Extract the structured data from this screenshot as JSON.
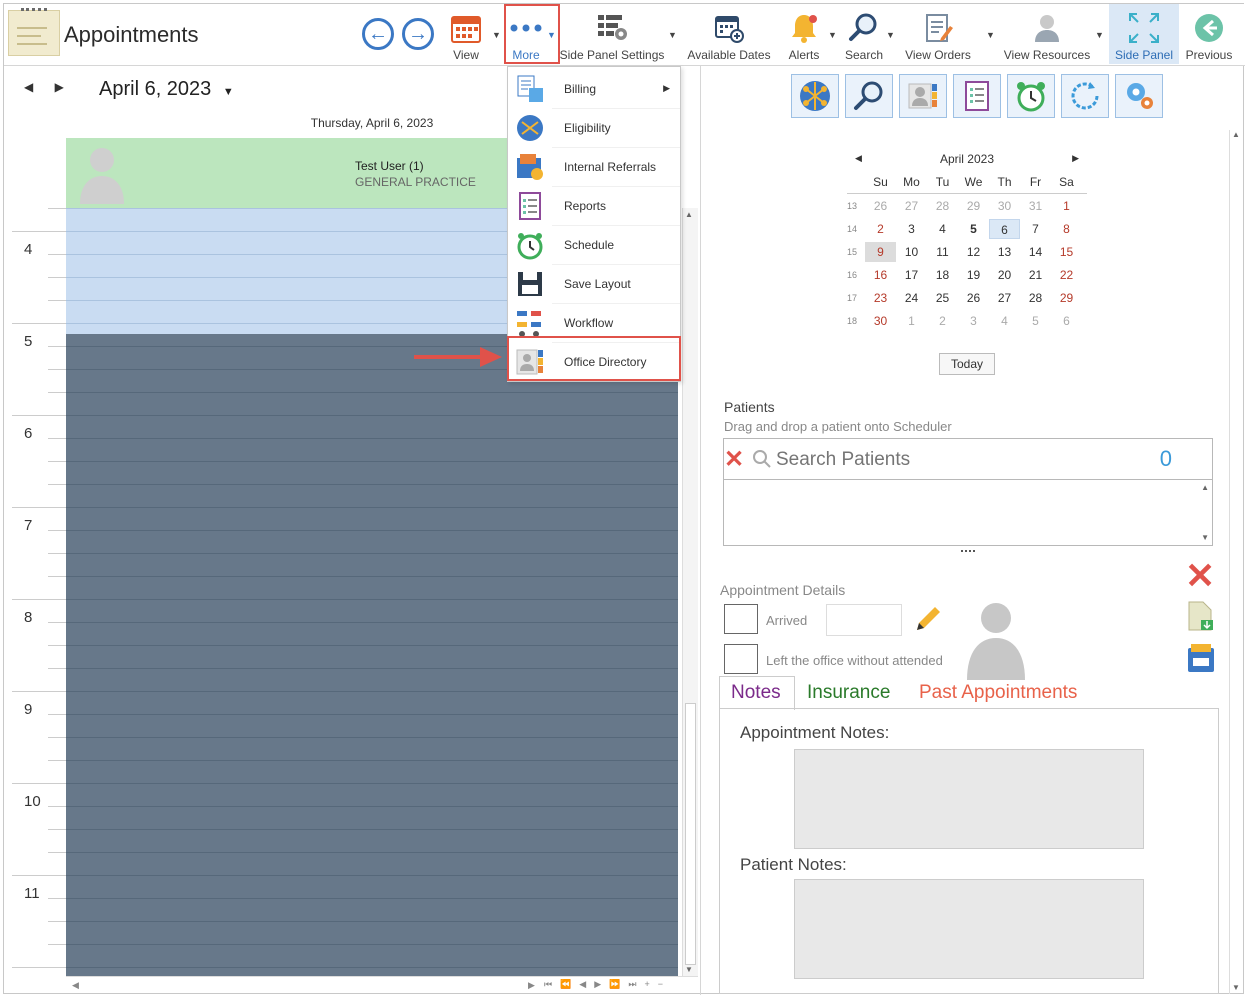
{
  "app": {
    "title": "Appointments"
  },
  "toolbar": {
    "view": "View",
    "more": "More",
    "side_panel_settings": "Side Panel Settings",
    "available_dates": "Available Dates",
    "alerts": "Alerts",
    "search": "Search",
    "view_orders": "View Orders",
    "view_resources": "View Resources",
    "side_panel": "Side Panel",
    "previous": "Previous"
  },
  "scheduler": {
    "date": "April 6, 2023",
    "day_header": "Thursday, April 6, 2023",
    "resource_name": "Test User (1)",
    "resource_practice": "GENERAL PRACTICE",
    "hours": [
      "4",
      "5",
      "6",
      "7",
      "8",
      "9",
      "10",
      "11"
    ]
  },
  "more_menu": {
    "items": [
      {
        "label": "Billing",
        "icon": "billing-icon"
      },
      {
        "label": "Eligibility",
        "icon": "eligibility-icon"
      },
      {
        "label": "Internal Referrals",
        "icon": "referrals-icon"
      },
      {
        "label": "Reports",
        "icon": "reports-icon"
      },
      {
        "label": "Schedule",
        "icon": "schedule-icon"
      },
      {
        "label": "Save Layout",
        "icon": "save-icon"
      },
      {
        "label": "Workflow",
        "icon": "workflow-icon"
      },
      {
        "label": "Office Directory",
        "icon": "office-directory-icon"
      }
    ]
  },
  "calendar": {
    "month": "April 2023",
    "weekdays": [
      "Su",
      "Mo",
      "Tu",
      "We",
      "Th",
      "Fr",
      "Sa"
    ],
    "weeks": [
      {
        "wk": "13",
        "days": [
          "26",
          "27",
          "28",
          "29",
          "30",
          "31",
          "1"
        ]
      },
      {
        "wk": "14",
        "days": [
          "2",
          "3",
          "4",
          "5",
          "6",
          "7",
          "8"
        ]
      },
      {
        "wk": "15",
        "days": [
          "9",
          "10",
          "11",
          "12",
          "13",
          "14",
          "15"
        ]
      },
      {
        "wk": "16",
        "days": [
          "16",
          "17",
          "18",
          "19",
          "20",
          "21",
          "22"
        ]
      },
      {
        "wk": "17",
        "days": [
          "23",
          "24",
          "25",
          "26",
          "27",
          "28",
          "29"
        ]
      },
      {
        "wk": "18",
        "days": [
          "30",
          "1",
          "2",
          "3",
          "4",
          "5",
          "6"
        ]
      }
    ],
    "today_label": "Today"
  },
  "patients": {
    "title": "Patients",
    "hint": "Drag and drop a patient onto Scheduler",
    "search_placeholder": "Search Patients",
    "count": "0"
  },
  "appointment": {
    "title": "Appointment Details",
    "arrived": "Arrived",
    "left": "Left the office without attended"
  },
  "tabs": {
    "notes": "Notes",
    "insurance": "Insurance",
    "past": "Past Appointments"
  },
  "notes": {
    "appointment_notes": "Appointment Notes:",
    "patient_notes": "Patient Notes:"
  },
  "colors": {
    "accent": "#3b78c4",
    "highlight": "#e0524a",
    "resource_bg": "#bce6be",
    "grid_bg": "#67788a",
    "tab_notes": "#7b2a8a",
    "tab_insurance": "#2a7a2a",
    "tab_past": "#e8624a"
  }
}
